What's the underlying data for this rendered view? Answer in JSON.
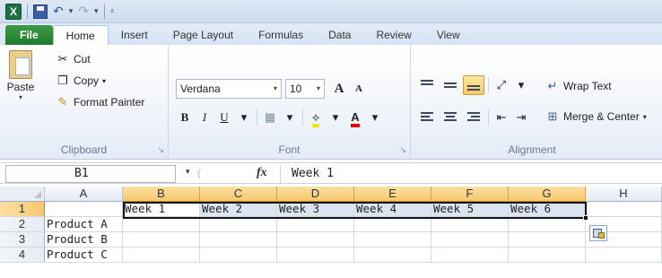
{
  "quick_access": {
    "app_icon": "excel-x-icon",
    "undo_glyph": "↶",
    "redo_glyph": "↷",
    "dropdown_glyph": "▾",
    "customize_glyph": "⩡"
  },
  "tabs": [
    {
      "label": "File"
    },
    {
      "label": "Home"
    },
    {
      "label": "Insert"
    },
    {
      "label": "Page Layout"
    },
    {
      "label": "Formulas"
    },
    {
      "label": "Data"
    },
    {
      "label": "Review"
    },
    {
      "label": "View"
    }
  ],
  "ribbon": {
    "clipboard": {
      "label": "Clipboard",
      "paste": "Paste",
      "cut": "Cut",
      "copy": "Copy",
      "format_painter": "Format Painter"
    },
    "font": {
      "label": "Font",
      "font_name": "Verdana",
      "font_size": "10",
      "grow": "A",
      "shrink": "A",
      "bold": "B",
      "italic": "I",
      "underline": "U",
      "font_color_letter": "A",
      "highlight_color": "#ffe400",
      "font_color": "#e00000"
    },
    "alignment": {
      "label": "Alignment",
      "wrap_text": "Wrap Text",
      "merge_center": "Merge & Center"
    }
  },
  "formula_bar": {
    "name_box": "B1",
    "fx": "fx",
    "content": "Week 1"
  },
  "sheet": {
    "columns": [
      "A",
      "B",
      "C",
      "D",
      "E",
      "F",
      "G",
      "H"
    ],
    "rows": [
      {
        "num": "1",
        "cells": [
          "",
          "Week 1",
          "Week 2",
          "Week 3",
          "Week 4",
          "Week 5",
          "Week 6",
          ""
        ]
      },
      {
        "num": "2",
        "cells": [
          "Product A",
          "",
          "",
          "",
          "",
          "",
          "",
          ""
        ]
      },
      {
        "num": "3",
        "cells": [
          "Product B",
          "",
          "",
          "",
          "",
          "",
          "",
          ""
        ]
      },
      {
        "num": "4",
        "cells": [
          "Product C",
          "",
          "",
          "",
          "",
          "",
          "",
          ""
        ]
      }
    ],
    "selection": "B1:G1",
    "selection_color": "#dbe5f1",
    "header_highlight": "#f6c86d"
  }
}
